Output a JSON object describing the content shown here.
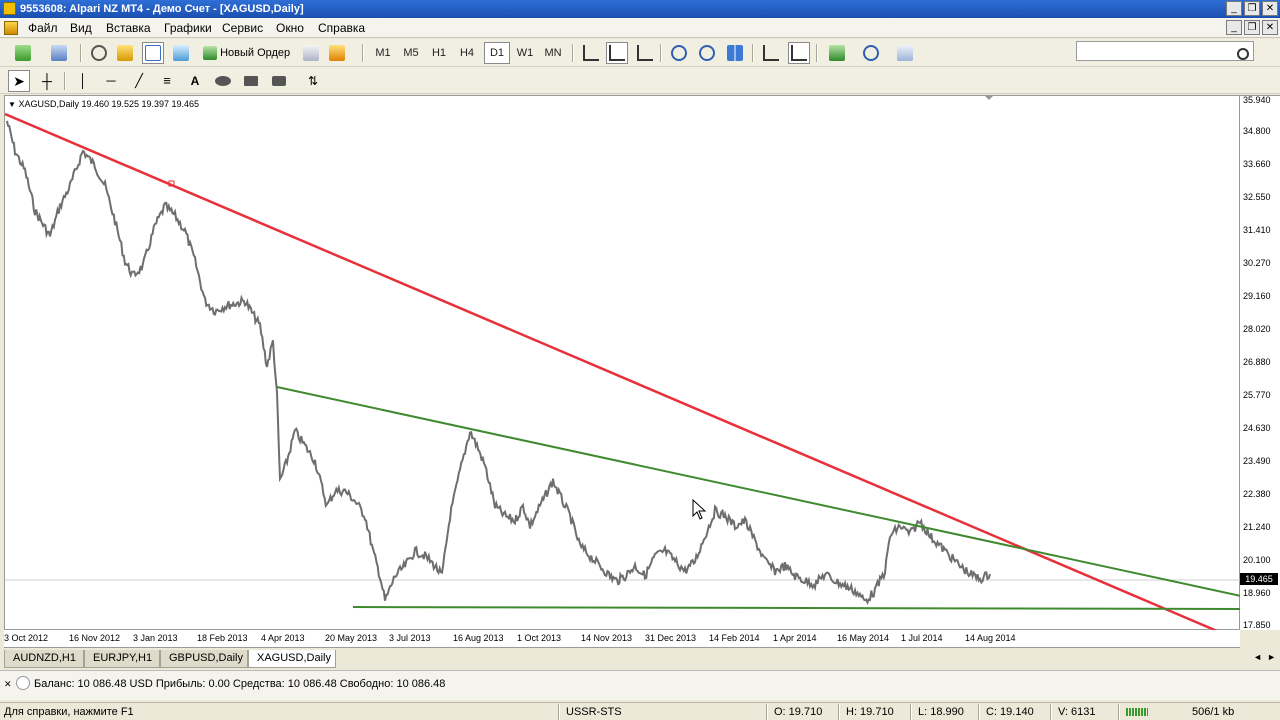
{
  "window": {
    "title": "9553608: Alpari NZ MT4 - Демо Счет - [XAGUSD,Daily]",
    "controls": [
      "_",
      "❐",
      "✕"
    ],
    "inner_controls": [
      "_",
      "❐",
      "✕"
    ]
  },
  "menu": [
    "Файл",
    "Вид",
    "Вставка",
    "Графики",
    "Сервис",
    "Окно",
    "Справка"
  ],
  "toolbar": {
    "new_order_label": "Новый Ордер",
    "timeframes": [
      "M1",
      "M5",
      "H1",
      "H4",
      "D1",
      "W1",
      "MN"
    ],
    "active_timeframe": "D1",
    "search_placeholder": ""
  },
  "chart": {
    "label": "XAGUSD,Daily  19.460 19.525 19.397 19.465",
    "current_price": "19.465",
    "price_ticks": [
      "35.940",
      "34.800",
      "33.660",
      "32.550",
      "31.410",
      "30.270",
      "29.160",
      "28.020",
      "26.880",
      "25.770",
      "24.630",
      "23.490",
      "22.380",
      "21.240",
      "20.100",
      "18.960",
      "17.850"
    ],
    "time_ticks": [
      "3 Oct 2012",
      "16 Nov 2012",
      "3 Jan 2013",
      "18 Feb 2013",
      "4 Apr 2013",
      "20 May 2013",
      "3 Jul 2013",
      "16 Aug 2013",
      "1 Oct 2013",
      "14 Nov 2013",
      "31 Dec 2013",
      "14 Feb 2014",
      "1 Apr 2014",
      "16 May 2014",
      "1 Jul 2014",
      "14 Aug 2014"
    ],
    "colors": {
      "price_line": "#6e6e6e",
      "trend_red": "#e8303a",
      "trend_green": "#3f8a2f"
    }
  },
  "tabs": [
    "AUDNZD,H1",
    "EURJPY,H1",
    "GBPUSD,Daily",
    "XAGUSD,Daily"
  ],
  "active_tab": "XAGUSD,Daily",
  "terminal": {
    "summary": "Баланс: 10 086.48 USD  Прибыль: 0.00  Средства: 10 086.48  Свободно: 10 086.48"
  },
  "status": {
    "help": "Для справки, нажмите F1",
    "profile": "USSR-STS",
    "open": "O: 19.710",
    "high": "H: 19.710",
    "low": "L: 18.990",
    "close": "C: 19.140",
    "volume": "V: 6131",
    "traffic": "506/1 kb"
  }
}
